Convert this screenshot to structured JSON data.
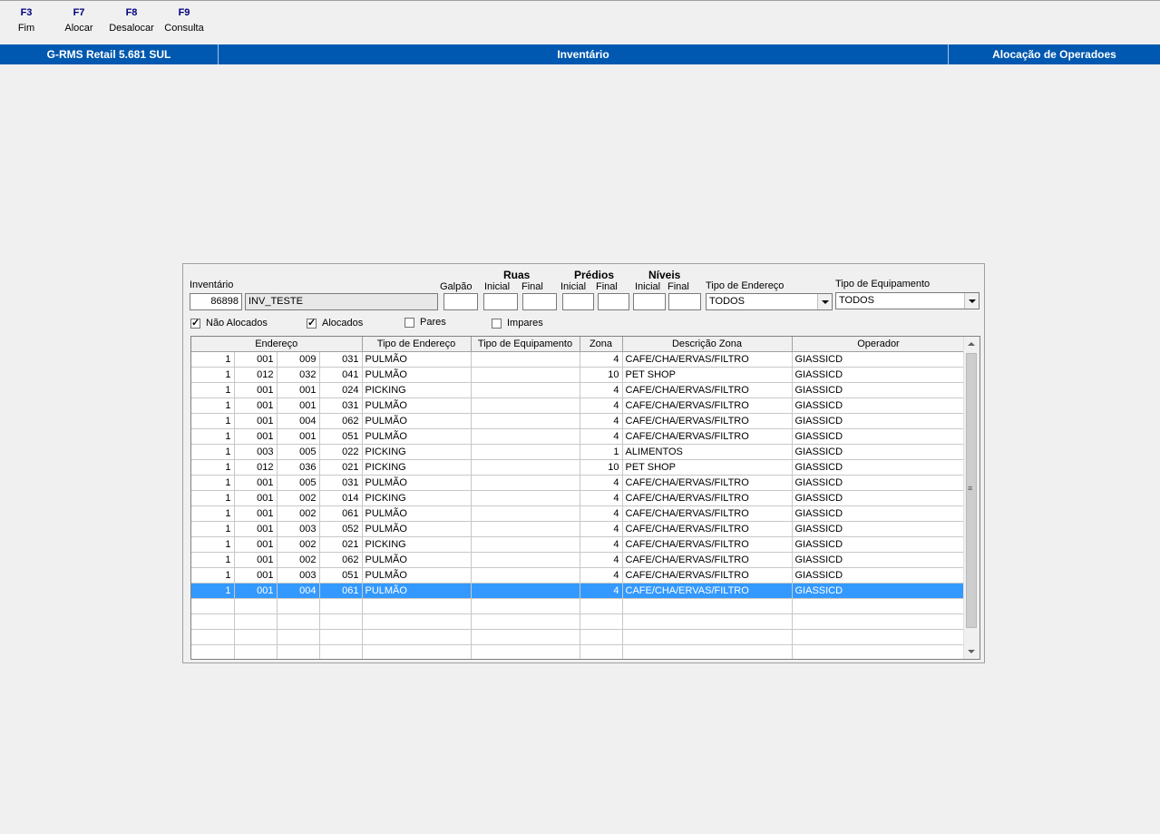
{
  "function_keys": [
    {
      "key": "F3",
      "label": "Fim"
    },
    {
      "key": "F7",
      "label": "Alocar"
    },
    {
      "key": "F8",
      "label": "Desalocar"
    },
    {
      "key": "F9",
      "label": "Consulta"
    }
  ],
  "titlebar": {
    "app": "G-RMS Retail 5.681 SUL",
    "module": "Inventário",
    "screen": "Alocação de Operadoes"
  },
  "filters": {
    "inventario_label": "Inventário",
    "inventario_code": "86898",
    "inventario_name": "INV_TESTE",
    "galpao_label": "Galpão",
    "ruas_label": "Ruas",
    "predios_label": "Prédios",
    "niveis_label": "Níveis",
    "inicial_label": "Inicial",
    "final_label": "Final",
    "tipo_endereco_label": "Tipo de Endereço",
    "tipo_endereco_value": "TODOS",
    "tipo_equipamento_label": "Tipo de Equipamento",
    "tipo_equipamento_value": "TODOS",
    "nao_alocados_label": "Não Alocados",
    "nao_alocados_checked": true,
    "alocados_label": "Alocados",
    "alocados_checked": true,
    "pares_label": "Pares",
    "pares_checked": false,
    "impares_label": "Impares",
    "impares_checked": false
  },
  "grid": {
    "columns": [
      "Endereço",
      "Tipo de Endereço",
      "Tipo de Equipamento",
      "Zona",
      "Descrição Zona",
      "Operador"
    ],
    "rows": [
      [
        "1",
        "001",
        "009",
        "031",
        "PULMÃO",
        "",
        "4",
        "CAFE/CHA/ERVAS/FILTRO",
        "GIASSICD"
      ],
      [
        "1",
        "012",
        "032",
        "041",
        "PULMÃO",
        "",
        "10",
        "PET SHOP",
        "GIASSICD"
      ],
      [
        "1",
        "001",
        "001",
        "024",
        "PICKING",
        "",
        "4",
        "CAFE/CHA/ERVAS/FILTRO",
        "GIASSICD"
      ],
      [
        "1",
        "001",
        "001",
        "031",
        "PULMÃO",
        "",
        "4",
        "CAFE/CHA/ERVAS/FILTRO",
        "GIASSICD"
      ],
      [
        "1",
        "001",
        "004",
        "062",
        "PULMÃO",
        "",
        "4",
        "CAFE/CHA/ERVAS/FILTRO",
        "GIASSICD"
      ],
      [
        "1",
        "001",
        "001",
        "051",
        "PULMÃO",
        "",
        "4",
        "CAFE/CHA/ERVAS/FILTRO",
        "GIASSICD"
      ],
      [
        "1",
        "003",
        "005",
        "022",
        "PICKING",
        "",
        "1",
        "ALIMENTOS",
        "GIASSICD"
      ],
      [
        "1",
        "012",
        "036",
        "021",
        "PICKING",
        "",
        "10",
        "PET SHOP",
        "GIASSICD"
      ],
      [
        "1",
        "001",
        "005",
        "031",
        "PULMÃO",
        "",
        "4",
        "CAFE/CHA/ERVAS/FILTRO",
        "GIASSICD"
      ],
      [
        "1",
        "001",
        "002",
        "014",
        "PICKING",
        "",
        "4",
        "CAFE/CHA/ERVAS/FILTRO",
        "GIASSICD"
      ],
      [
        "1",
        "001",
        "002",
        "061",
        "PULMÃO",
        "",
        "4",
        "CAFE/CHA/ERVAS/FILTRO",
        "GIASSICD"
      ],
      [
        "1",
        "001",
        "003",
        "052",
        "PULMÃO",
        "",
        "4",
        "CAFE/CHA/ERVAS/FILTRO",
        "GIASSICD"
      ],
      [
        "1",
        "001",
        "002",
        "021",
        "PICKING",
        "",
        "4",
        "CAFE/CHA/ERVAS/FILTRO",
        "GIASSICD"
      ],
      [
        "1",
        "001",
        "002",
        "062",
        "PULMÃO",
        "",
        "4",
        "CAFE/CHA/ERVAS/FILTRO",
        "GIASSICD"
      ],
      [
        "1",
        "001",
        "003",
        "051",
        "PULMÃO",
        "",
        "4",
        "CAFE/CHA/ERVAS/FILTRO",
        "GIASSICD"
      ],
      [
        "1",
        "001",
        "004",
        "061",
        "PULMÃO",
        "",
        "4",
        "CAFE/CHA/ERVAS/FILTRO",
        "GIASSICD"
      ]
    ],
    "selected_row": 15,
    "empty_rows": 4
  },
  "colors": {
    "titlebar": "#0058b0",
    "selection": "#3399ff",
    "fkey_text": "#000080"
  }
}
